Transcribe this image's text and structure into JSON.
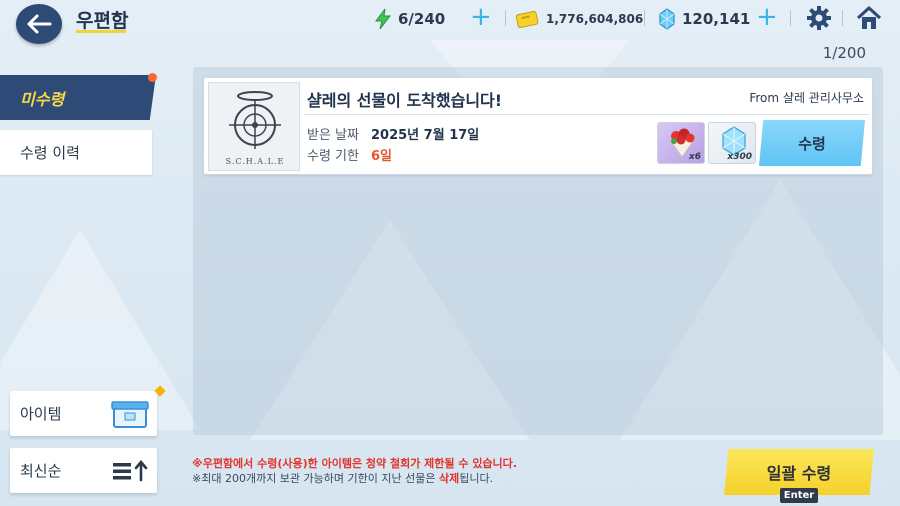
{
  "header": {
    "title": "우편함",
    "ap": "6/240",
    "credits": "1,776,604,806",
    "pyroxene": "120,141"
  },
  "counter": "1/200",
  "tabs": {
    "unreceived": "미수령",
    "history": "수령 이력"
  },
  "sidebar": {
    "item_label": "아이템",
    "sort_label": "최신순"
  },
  "mail": {
    "sender_logo": "S.C.H.A.L.E",
    "title": "샬레의 선물이 도착했습니다!",
    "from": "From 샬레 관리사무소",
    "received_label": "받은 날짜",
    "received_value": "2025년 7월 17일",
    "deadline_label": "수령 기한",
    "deadline_value": "6일",
    "rewards": [
      {
        "icon": "gift-bouquet-icon",
        "qty": "x6"
      },
      {
        "icon": "pyroxene-crystal-icon",
        "qty": "x300"
      }
    ],
    "receive_label": "수령"
  },
  "notes": {
    "line1": "※우편함에서 수령(사용)한 아이템은 청약 철회가 제한될 수 있습니다.",
    "line2_a": "※최대 200개까지 보관 가능하며 기한이 지난 선물은 ",
    "line2_b": "삭제",
    "line2_c": "됩니다."
  },
  "bulk": {
    "label": "일괄 수령",
    "key": "Enter"
  },
  "colors": {
    "navy": "#2e4b78",
    "accent_yellow": "#f5d12b",
    "accent_blue": "#5fc4f5",
    "warning_red": "#e2342c",
    "deadline_orange": "#e4572e"
  }
}
